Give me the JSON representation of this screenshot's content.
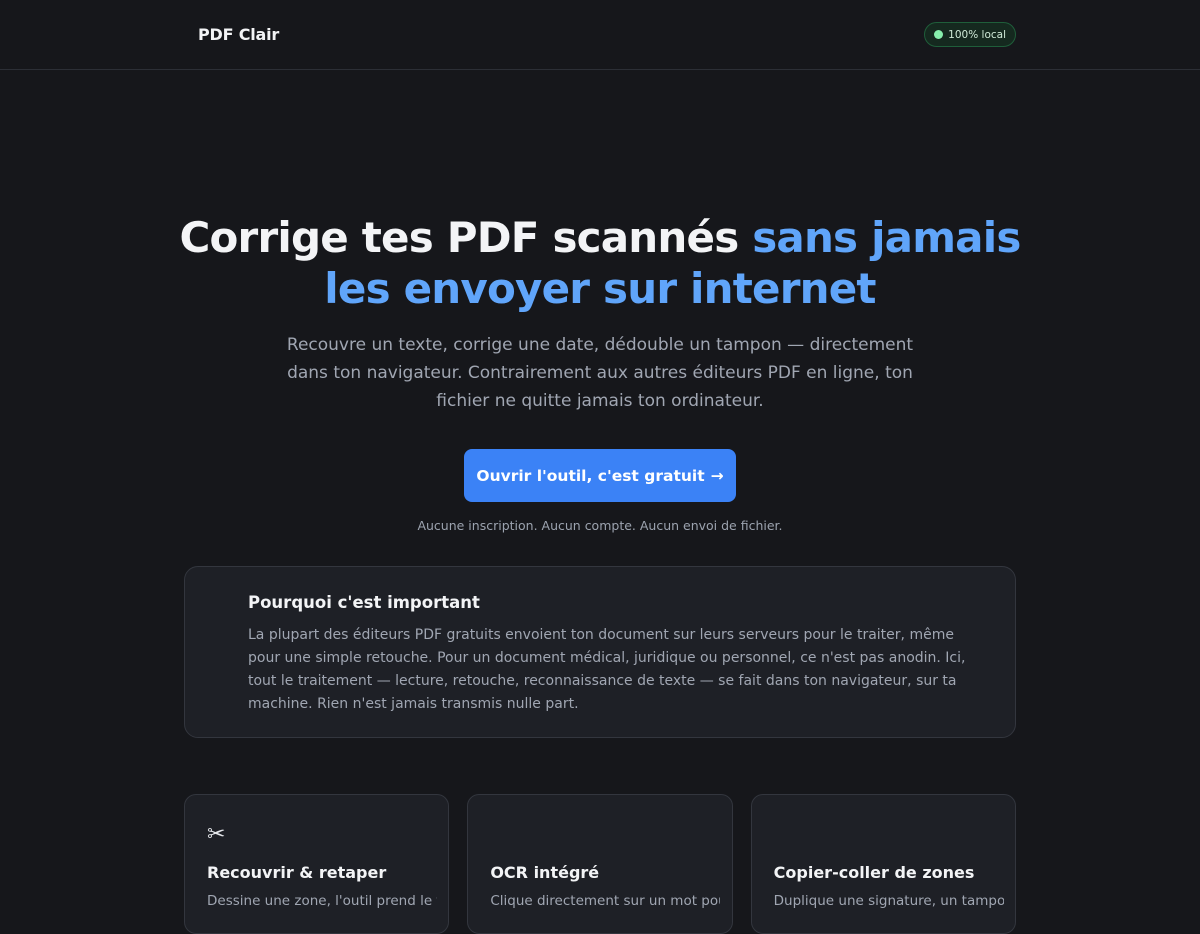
{
  "header": {
    "brand": "PDF Clair",
    "badge_label": "100% local"
  },
  "hero": {
    "title_main": "Corrige tes PDF scannés ",
    "title_accent": "sans jamais les envoyer sur internet",
    "subtitle": "Recouvre un texte, corrige une date, dédouble un tampon — directement dans ton navigateur. Contrairement aux autres éditeurs PDF en ligne, ton fichier ne quitte jamais ton ordinateur.",
    "cta_label": "Ouvrir l'outil, c'est gratuit",
    "cta_arrow": "→",
    "note": "Aucune inscription. Aucun compte. Aucun envoi de fichier."
  },
  "why": {
    "title": "Pourquoi c'est important",
    "text": "La plupart des éditeurs PDF gratuits envoient ton document sur leurs serveurs pour le traiter, même pour une simple retouche. Pour un document médical, juridique ou personnel, ce n'est pas anodin. Ici, tout le traitement — lecture, retouche, reconnaissance de texte — se fait dans ton navigateur, sur ta machine. Rien n'est jamais transmis nulle part."
  },
  "features": [
    {
      "icon": "scissors-icon",
      "icon_glyph": "✂",
      "title": "Recouvrir & retaper",
      "desc": "Dessine une zone, l'outil prend le fond..."
    },
    {
      "icon": "",
      "icon_glyph": "",
      "title": "OCR intégré",
      "desc": "Clique directement sur un mot pour le..."
    },
    {
      "icon": "",
      "icon_glyph": "",
      "title": "Copier-coller de zones",
      "desc": "Duplique une signature, un tampon..."
    }
  ],
  "colors": {
    "background": "#16171b",
    "accent": "#60a5fa",
    "cta": "#3b82f6",
    "badge_dot": "#86efac"
  }
}
